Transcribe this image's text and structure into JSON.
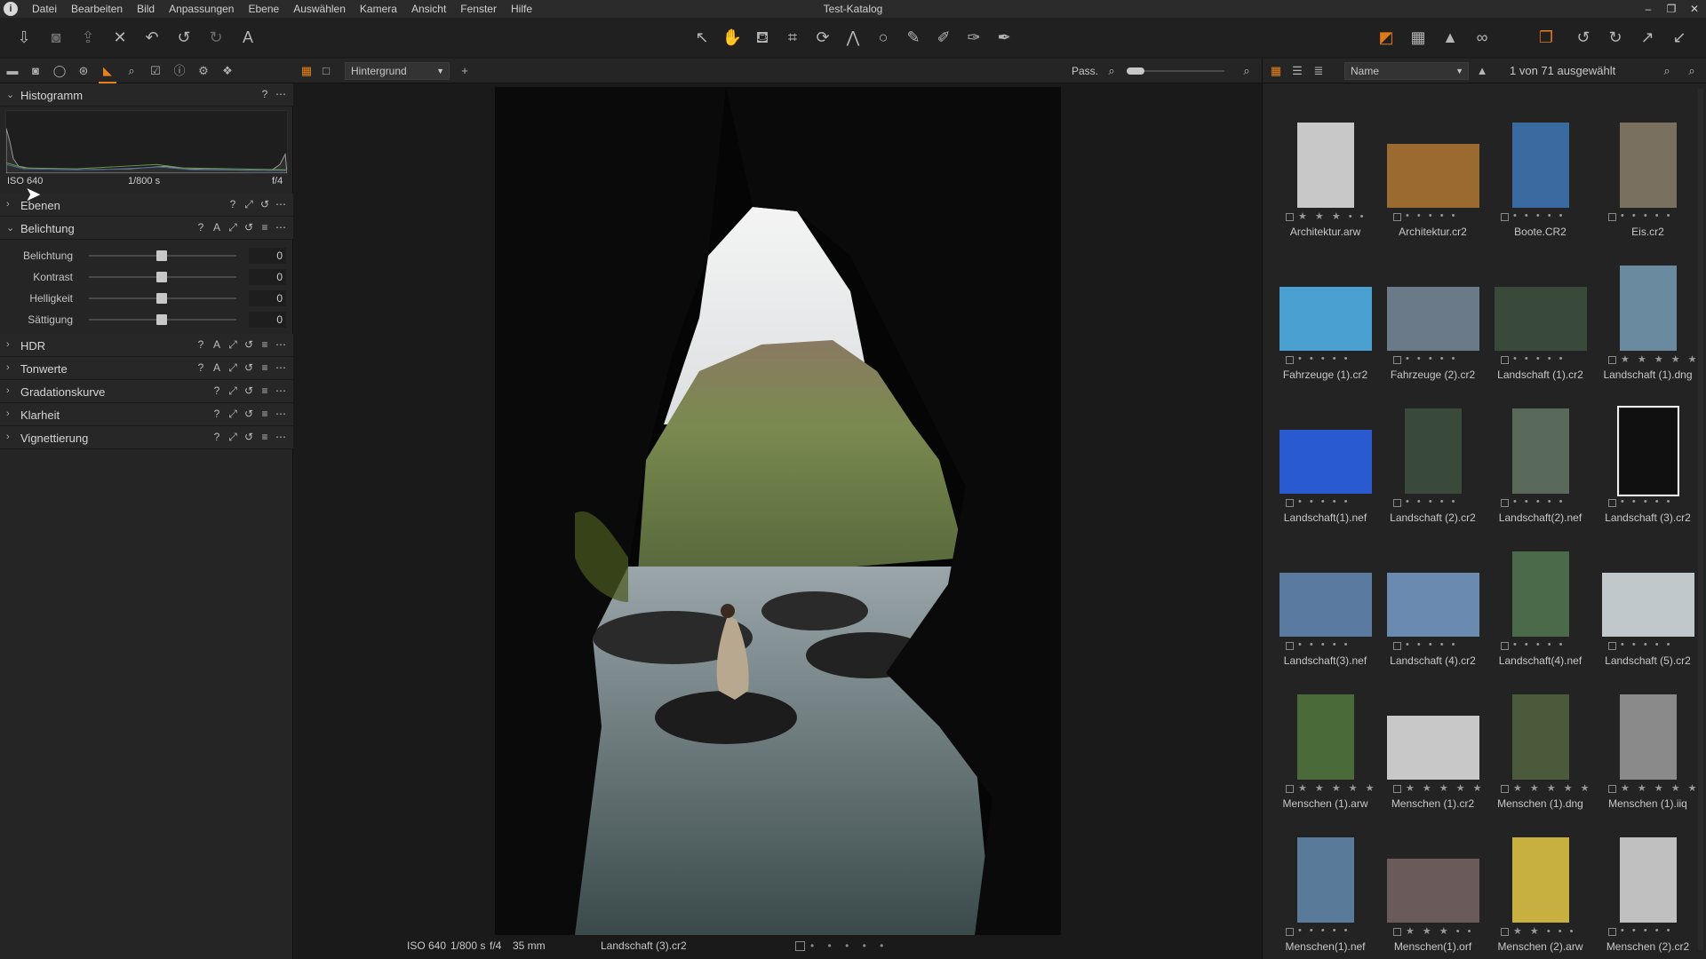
{
  "menubar": {
    "items": [
      "Datei",
      "Bearbeiten",
      "Bild",
      "Anpassungen",
      "Ebene",
      "Auswählen",
      "Kamera",
      "Ansicht",
      "Fenster",
      "Hilfe"
    ],
    "window_title": "Test-Katalog",
    "app_icon": "i"
  },
  "left_panel": {
    "histogram": {
      "title": "Histogramm",
      "iso": "ISO 640",
      "shutter": "1/800 s",
      "aperture": "f/4"
    },
    "sections": {
      "ebenen": "Ebenen",
      "belichtung": "Belichtung",
      "hdr": "HDR",
      "tonwerte": "Tonwerte",
      "gradation": "Gradationskurve",
      "klarheit": "Klarheit",
      "vignette": "Vignettierung"
    },
    "sliders": [
      {
        "label": "Belichtung",
        "value": "0"
      },
      {
        "label": "Kontrast",
        "value": "0"
      },
      {
        "label": "Helligkeit",
        "value": "0"
      },
      {
        "label": "Sättigung",
        "value": "0"
      }
    ],
    "tool_glyphs": {
      "help": "?",
      "auto": "A",
      "copy": "⤢",
      "reset": "↺",
      "list": "≡",
      "more": "⋯"
    }
  },
  "viewer": {
    "layer": "Hintergrund",
    "zoom_label": "Pass.",
    "footer": {
      "iso": "ISO 640",
      "shutter": "1/800 s",
      "aperture": "f/4",
      "focal": "35 mm",
      "filename": "Landschaft (3).cr2",
      "rating": "• • • • •"
    }
  },
  "browser": {
    "sort": "Name",
    "count": "1 von 71 ausgewählt",
    "thumbs": [
      {
        "name": "Architektur.arw",
        "stars": "★ ★ ★ • •"
      },
      {
        "name": "Architektur.cr2",
        "stars": "• • • • •"
      },
      {
        "name": "Boote.CR2",
        "stars": "• • • • •"
      },
      {
        "name": "Eis.cr2",
        "stars": "• • • • •"
      },
      {
        "name": "Fahrzeuge (1).cr2",
        "stars": "• • • • •"
      },
      {
        "name": "Fahrzeuge (2).cr2",
        "stars": "• • • • •"
      },
      {
        "name": "Landschaft (1).cr2",
        "stars": "• • • • •"
      },
      {
        "name": "Landschaft (1).dng",
        "stars": "★ ★ ★ ★ ★"
      },
      {
        "name": "Landschaft(1).nef",
        "stars": "• • • • •"
      },
      {
        "name": "Landschaft (2).cr2",
        "stars": "• • • • •"
      },
      {
        "name": "Landschaft(2).nef",
        "stars": "• • • • •"
      },
      {
        "name": "Landschaft (3).cr2",
        "stars": "• • • • •"
      },
      {
        "name": "Landschaft(3).nef",
        "stars": "• • • • •"
      },
      {
        "name": "Landschaft (4).cr2",
        "stars": "• • • • •"
      },
      {
        "name": "Landschaft(4).nef",
        "stars": "• • • • •"
      },
      {
        "name": "Landschaft (5).cr2",
        "stars": "• • • • •"
      },
      {
        "name": "Menschen (1).arw",
        "stars": "★ ★ ★ ★ ★"
      },
      {
        "name": "Menschen (1).cr2",
        "stars": "★ ★ ★ ★ ★"
      },
      {
        "name": "Menschen (1).dng",
        "stars": "★ ★ ★ ★ ★"
      },
      {
        "name": "Menschen (1).iiq",
        "stars": "★ ★ ★ ★ ★"
      },
      {
        "name": "Menschen(1).nef",
        "stars": "• • • • •"
      },
      {
        "name": "Menschen(1).orf",
        "stars": "★ ★ ★ • •"
      },
      {
        "name": "Menschen (2).arw",
        "stars": "★ ★ • • •"
      },
      {
        "name": "Menschen (2).cr2",
        "stars": "• • • • •"
      }
    ]
  },
  "colors": {
    "accent": "#e8811a",
    "panel": "#252525",
    "viewer": "#1a1a1a"
  }
}
